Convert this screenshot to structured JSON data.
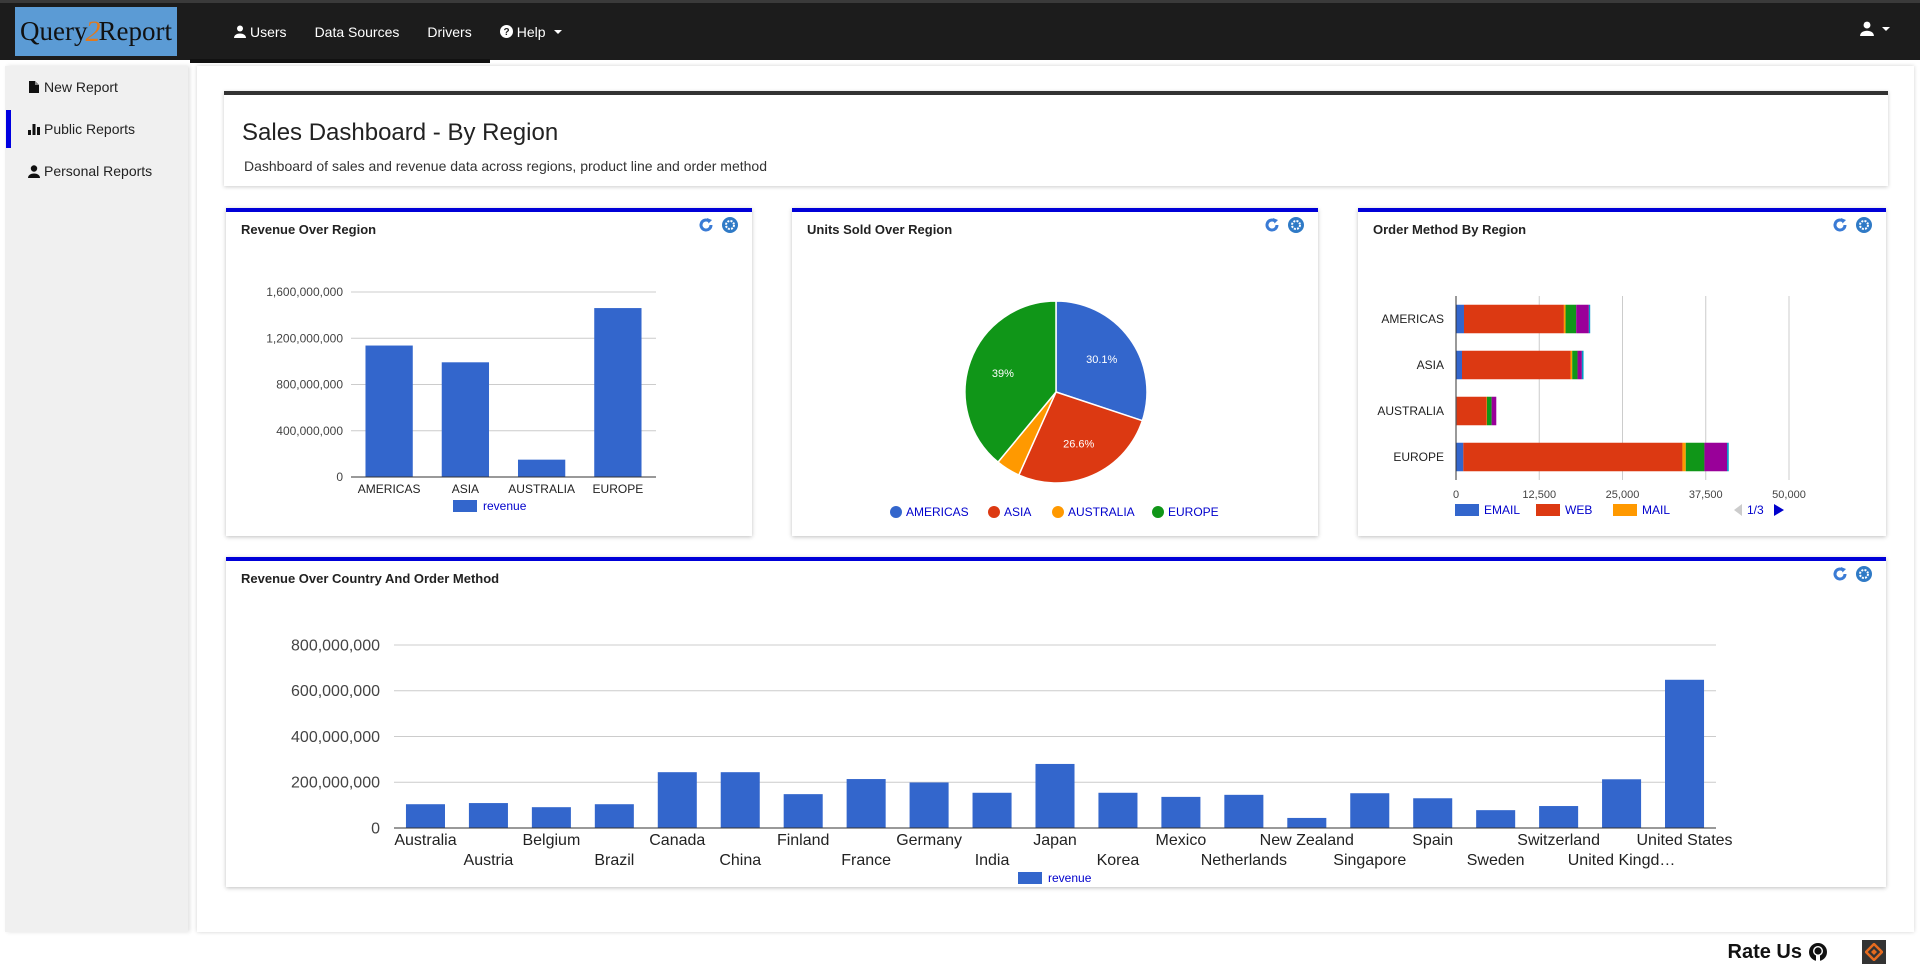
{
  "nav": {
    "brand_left": "Query",
    "brand_mid": "2",
    "brand_right": "Report",
    "items": [
      {
        "label": "Users",
        "icon": "user-icon"
      },
      {
        "label": "Data Sources"
      },
      {
        "label": "Drivers"
      },
      {
        "label": "Help",
        "icon": "question-circle-icon",
        "dropdown": true
      }
    ],
    "user_menu_icon": "user-icon"
  },
  "sidebar": {
    "items": [
      {
        "label": "New Report",
        "icon": "file-icon",
        "active": false
      },
      {
        "label": "Public Reports",
        "icon": "bar-chart-icon",
        "active": true
      },
      {
        "label": "Personal Reports",
        "icon": "user-icon",
        "active": false
      }
    ]
  },
  "dashboard": {
    "title": "Sales Dashboard - By Region",
    "description": "Dashboard of sales and revenue data across regions, product line and order method"
  },
  "panels": {
    "revenue_region": {
      "title": "Revenue Over Region"
    },
    "units_region": {
      "title": "Units Sold Over Region"
    },
    "order_method": {
      "title": "Order Method By Region",
      "pager": "1/3"
    },
    "revenue_country": {
      "title": "Revenue Over Country And Order Method"
    }
  },
  "footer": {
    "rate_label": "Rate Us"
  },
  "colors": {
    "accent": "#0000d8",
    "bar": "#3366cc",
    "red": "#dc3912",
    "orange": "#ff9900",
    "green": "#109618",
    "purple": "#990099",
    "link": "#0000cc"
  },
  "chart_data": [
    {
      "type": "bar",
      "title": "Revenue Over Region",
      "categories": [
        "AMERICAS",
        "ASIA",
        "AUSTRALIA",
        "EUROPE"
      ],
      "series": [
        {
          "name": "revenue",
          "values": [
            1137000000,
            992000000,
            150000000,
            1461000000
          ]
        }
      ],
      "yticks": [
        0,
        400000000,
        800000000,
        1200000000,
        1600000000
      ],
      "ytick_labels": [
        "0",
        "400,000,000",
        "800,000,000",
        "1,200,000,000",
        "1,600,000,000"
      ],
      "ylim": [
        0,
        1600000000
      ],
      "legend": "bottom",
      "grid": true
    },
    {
      "type": "pie",
      "title": "Units Sold Over Region",
      "categories": [
        "AMERICAS",
        "ASIA",
        "AUSTRALIA",
        "EUROPE"
      ],
      "values": [
        30.1,
        26.6,
        4.3,
        39.0
      ],
      "labels": [
        "30.1%",
        "26.6%",
        "",
        "39%"
      ],
      "colors": [
        "#3366cc",
        "#dc3912",
        "#ff9900",
        "#109618"
      ],
      "legend": "bottom"
    },
    {
      "type": "bar",
      "orientation": "horizontal",
      "stacked": true,
      "title": "Order Method By Region",
      "categories": [
        "AMERICAS",
        "ASIA",
        "AUSTRALIA",
        "EUROPE"
      ],
      "series": [
        {
          "name": "EMAIL",
          "color": "#3366cc",
          "values": [
            1200,
            900,
            100,
            1100
          ]
        },
        {
          "name": "WEB",
          "color": "#dc3912",
          "values": [
            15000,
            16300,
            4500,
            32900
          ]
        },
        {
          "name": "MAIL",
          "color": "#ff9900",
          "values": [
            250,
            250,
            50,
            500
          ]
        },
        {
          "name": "",
          "color": "#109618",
          "values": [
            1600,
            800,
            700,
            2800
          ]
        },
        {
          "name": "",
          "color": "#990099",
          "values": [
            1900,
            650,
            700,
            3400
          ]
        },
        {
          "name": "",
          "color": "#0099c6",
          "values": [
            200,
            250,
            0,
            250
          ]
        }
      ],
      "xticks": [
        0,
        12500,
        25000,
        37500,
        50000
      ],
      "xtick_labels": [
        "0",
        "12,500",
        "25,000",
        "37,500",
        "50,000"
      ],
      "xlim": [
        0,
        50000
      ],
      "legend_visible": [
        "EMAIL",
        "WEB",
        "MAIL"
      ],
      "legend": "bottom",
      "grid": true
    },
    {
      "type": "bar",
      "title": "Revenue Over Country And Order Method",
      "categories": [
        "Australia",
        "Austria",
        "Belgium",
        "Brazil",
        "Canada",
        "China",
        "Finland",
        "France",
        "Germany",
        "India",
        "Japan",
        "Korea",
        "Mexico",
        "Netherlands",
        "New Zealand",
        "Singapore",
        "Spain",
        "Sweden",
        "Switzerland",
        "United Kingd…",
        "United States"
      ],
      "series": [
        {
          "name": "revenue",
          "values": [
            104000000,
            109000000,
            91000000,
            104000000,
            244000000,
            244000000,
            148000000,
            214000000,
            199000000,
            154000000,
            280000000,
            154000000,
            136000000,
            145000000,
            44000000,
            152000000,
            130000000,
            78000000,
            96000000,
            213000000,
            648000000
          ]
        }
      ],
      "yticks": [
        0,
        200000000,
        400000000,
        600000000,
        800000000
      ],
      "ytick_labels": [
        "0",
        "200,000,000",
        "400,000,000",
        "600,000,000",
        "800,000,000"
      ],
      "ylim": [
        0,
        800000000
      ],
      "legend": "bottom",
      "grid": true
    }
  ]
}
